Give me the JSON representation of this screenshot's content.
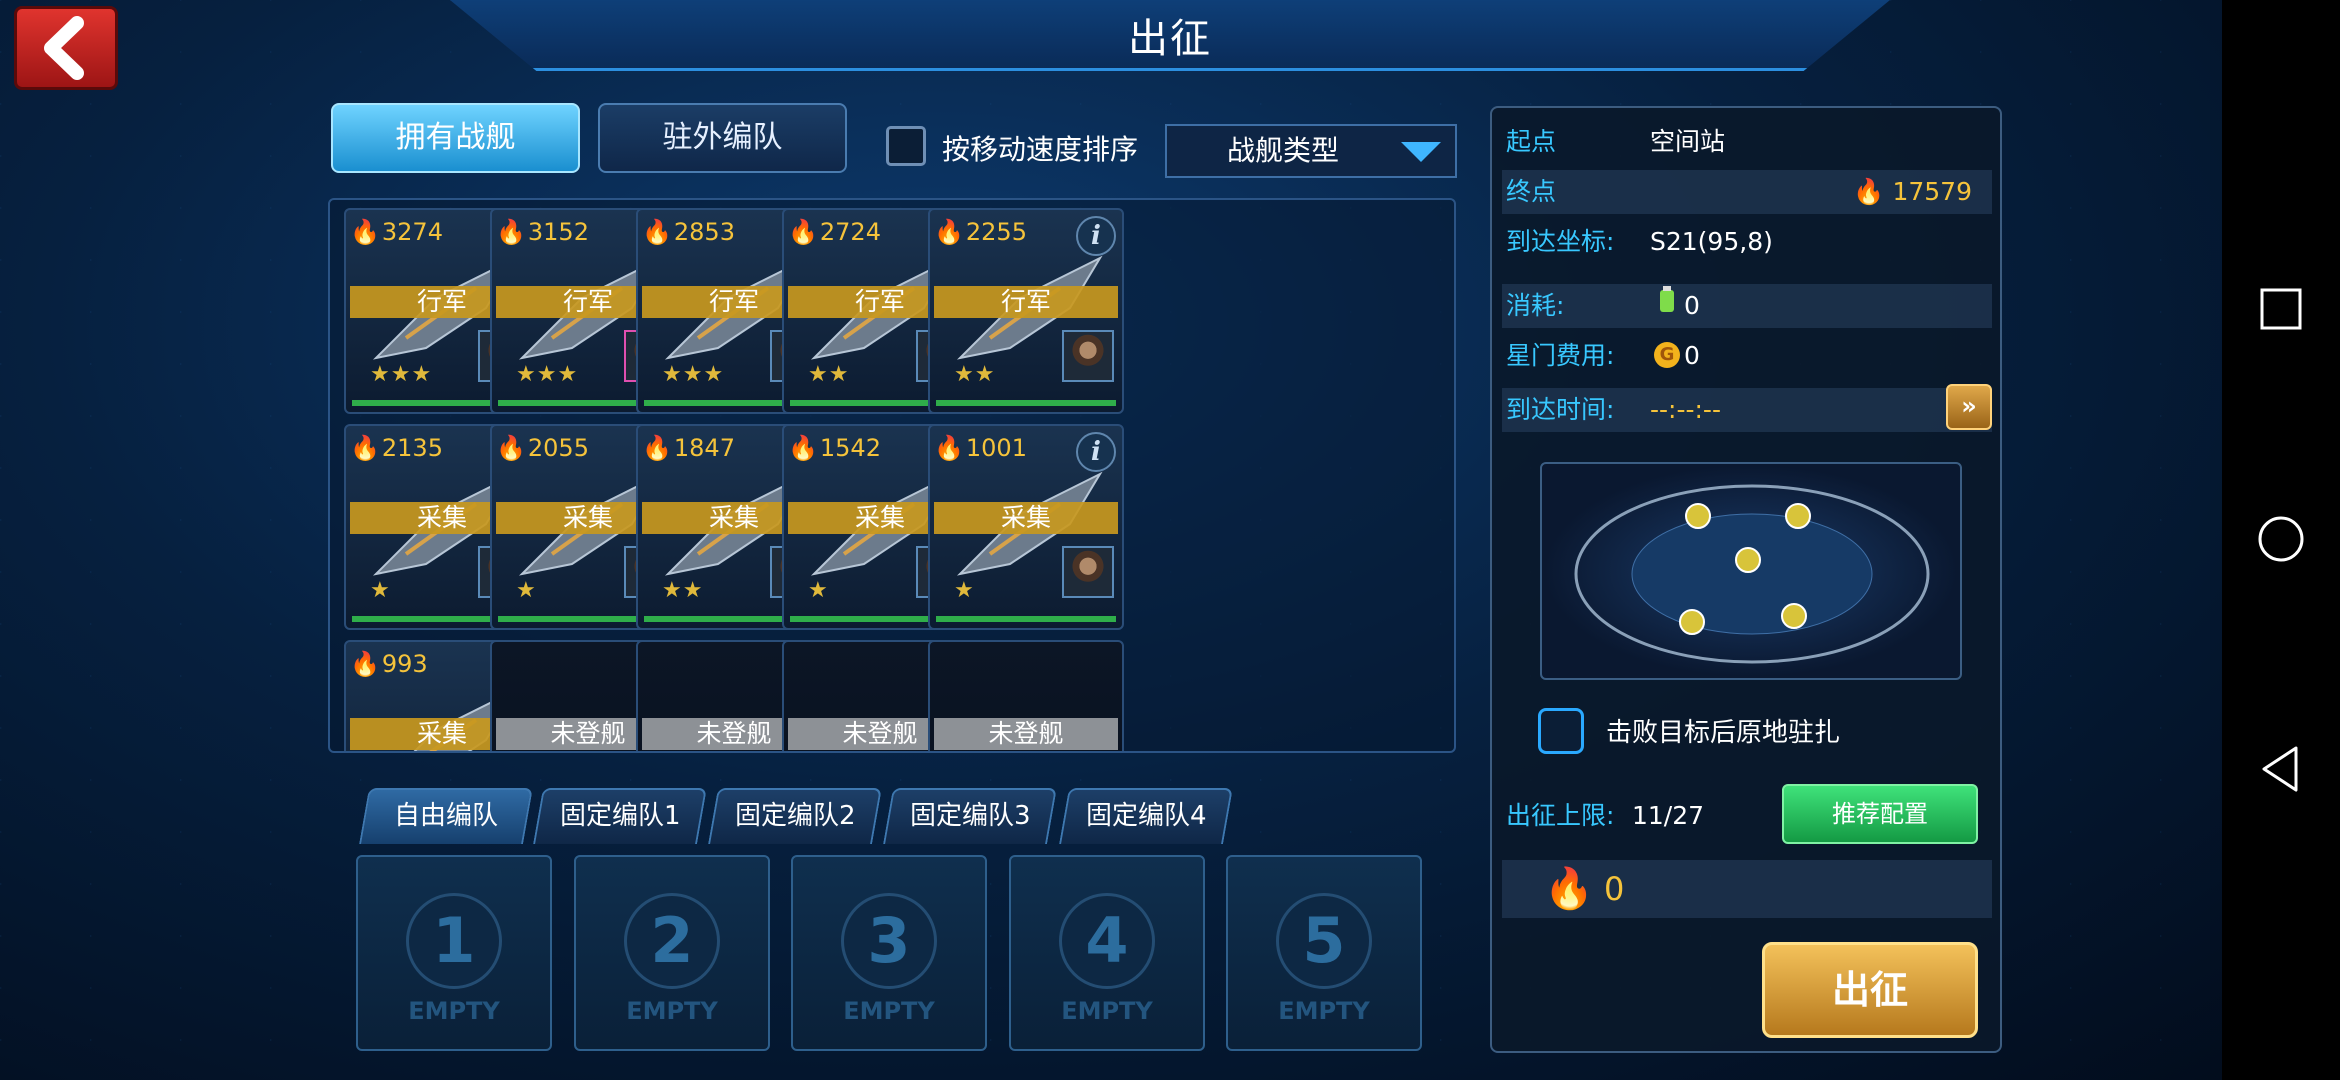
{
  "header": {
    "title": "出征"
  },
  "tabs": {
    "owned": "拥有战舰",
    "stationed": "驻外编队"
  },
  "sort_checkbox_label": "按移动速度排序",
  "ship_type_dropdown": "战舰类型",
  "ships": [
    {
      "power": "3274",
      "status": "行军",
      "stars": "★★★"
    },
    {
      "power": "3152",
      "status": "行军",
      "stars": "★★★"
    },
    {
      "power": "2853",
      "status": "行军",
      "stars": "★★★"
    },
    {
      "power": "2724",
      "status": "行军",
      "stars": "★★"
    },
    {
      "power": "2255",
      "status": "行军",
      "stars": "★★"
    },
    {
      "power": "2135",
      "status": "采集",
      "stars": "★"
    },
    {
      "power": "2055",
      "status": "采集",
      "stars": "★"
    },
    {
      "power": "1847",
      "status": "采集",
      "stars": "★★"
    },
    {
      "power": "1542",
      "status": "采集",
      "stars": "★"
    },
    {
      "power": "1001",
      "status": "采集",
      "stars": "★"
    },
    {
      "power": "993",
      "status": "采集",
      "stars": ""
    },
    {
      "status": "未登舰"
    },
    {
      "status": "未登舰"
    },
    {
      "status": "未登舰"
    },
    {
      "status": "未登舰"
    }
  ],
  "formation_tabs": [
    "自由编队",
    "固定编队1",
    "固定编队2",
    "固定编队3",
    "固定编队4"
  ],
  "slots": [
    {
      "num": "1",
      "label": "EMPTY"
    },
    {
      "num": "2",
      "label": "EMPTY"
    },
    {
      "num": "3",
      "label": "EMPTY"
    },
    {
      "num": "4",
      "label": "EMPTY"
    },
    {
      "num": "5",
      "label": "EMPTY"
    }
  ],
  "march": {
    "start_label": "起点",
    "start_value": "空间站",
    "end_label": "终点",
    "end_power": "17579",
    "coord_label": "到达坐标:",
    "coord_value": "S21(95,8)",
    "cost_label": "消耗:",
    "cost_value": "0",
    "gate_label": "星门费用:",
    "gate_value": "0",
    "time_label": "到达时间:",
    "time_value": "--:--:--",
    "garrison_label": "击败目标后原地驻扎",
    "limit_label": "出征上限:",
    "limit_value": "11/27",
    "recommend_button": "推荐配置",
    "total_power": "0",
    "go_button": "出征"
  },
  "colors": {
    "accent_cyan": "#38c8ff",
    "gold": "#f5c33b",
    "march_status": "#c8981e",
    "empty_status": "#8d9196"
  },
  "icons": {
    "back": "chevron-left-icon",
    "help": "question-icon",
    "info": "info-icon",
    "power": "flame-icon",
    "fast_forward": "double-chevron-right-icon"
  }
}
